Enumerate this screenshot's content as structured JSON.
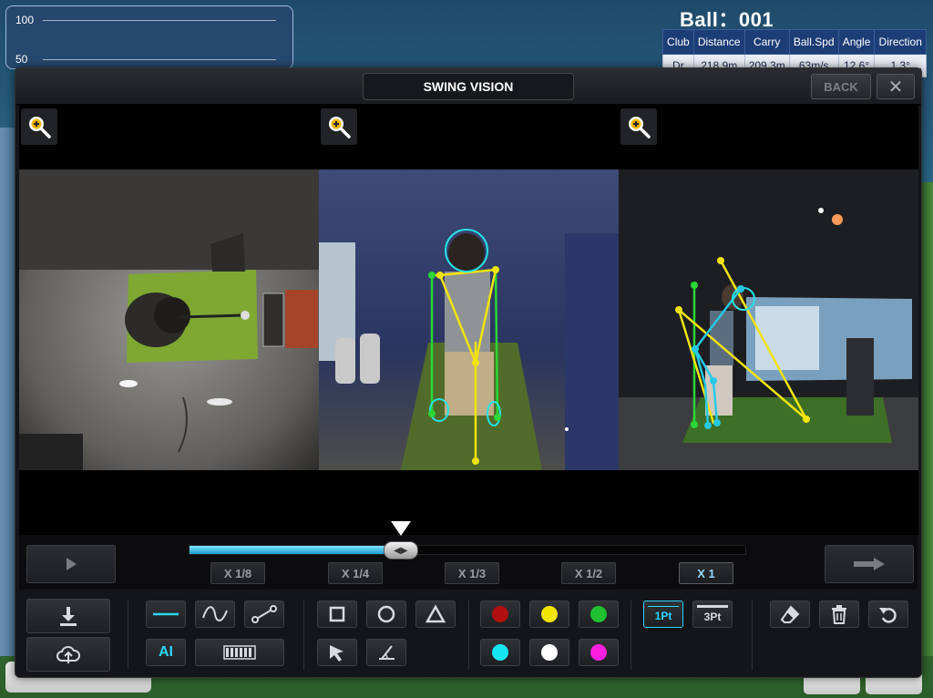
{
  "background": {
    "graph_ticks": [
      "100",
      "50"
    ],
    "ball_label": "Ball：001",
    "shot_table": {
      "headers": [
        "Club",
        "Distance",
        "Carry",
        "Ball.Spd",
        "Angle",
        "Direction"
      ],
      "row": [
        "Dr",
        "218.9m",
        "209.3m",
        "63m/s",
        "12.6°",
        "1.3°"
      ]
    }
  },
  "modal": {
    "title": "SWING VISION",
    "back_label": "BACK",
    "close_symbol": "✕"
  },
  "panels": [
    {
      "view": "overhead",
      "zoom_icon": "zoom-in-icon"
    },
    {
      "view": "front",
      "zoom_icon": "zoom-in-icon"
    },
    {
      "view": "side",
      "zoom_icon": "zoom-in-icon"
    }
  ],
  "timeline": {
    "progress": 0.38,
    "speeds": [
      "X 1/8",
      "X 1/4",
      "X 1/3",
      "X 1/2",
      "X 1"
    ],
    "active_speed": "X 1"
  },
  "toolbar": {
    "ai_label": "AI",
    "line_1pt": "1Pt",
    "line_3pt": "3Pt",
    "colors": [
      "#b01010",
      "#f2e600",
      "#21c032",
      "#16e6f2",
      "#ffffff",
      "#ff1fe0"
    ],
    "accent": "#2ad6ff"
  }
}
